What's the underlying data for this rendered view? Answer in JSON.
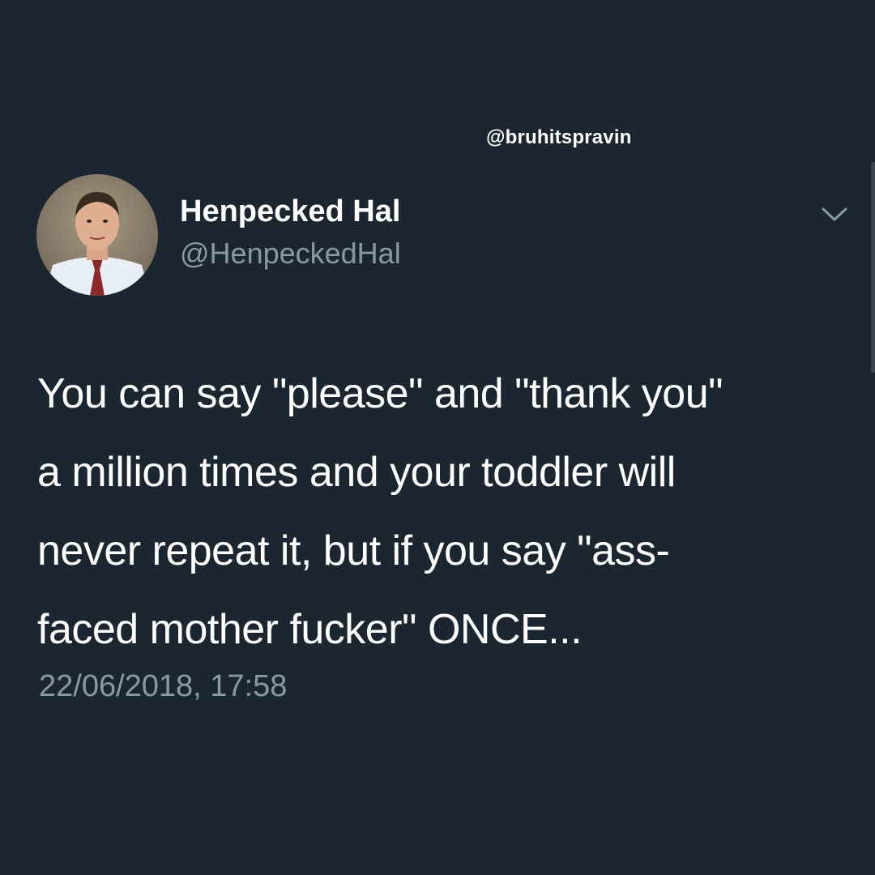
{
  "watermark": "@bruhitspravin",
  "tweet": {
    "display_name": "Henpecked Hal",
    "handle": "@HenpeckedHal",
    "text_lines": [
      "You can say \"please\" and \"thank you\"",
      "a million times and your toddler will",
      "never repeat it, but if you say \"ass-",
      "faced mother fucker\" ONCE..."
    ],
    "timestamp": "22/06/2018, 17:58",
    "menu_icon": "chevron-down-icon",
    "avatar_icon": "profile-photo"
  },
  "colors": {
    "background": "#1c2630",
    "primary_text": "#ffffff",
    "secondary_text": "#8899a6"
  }
}
